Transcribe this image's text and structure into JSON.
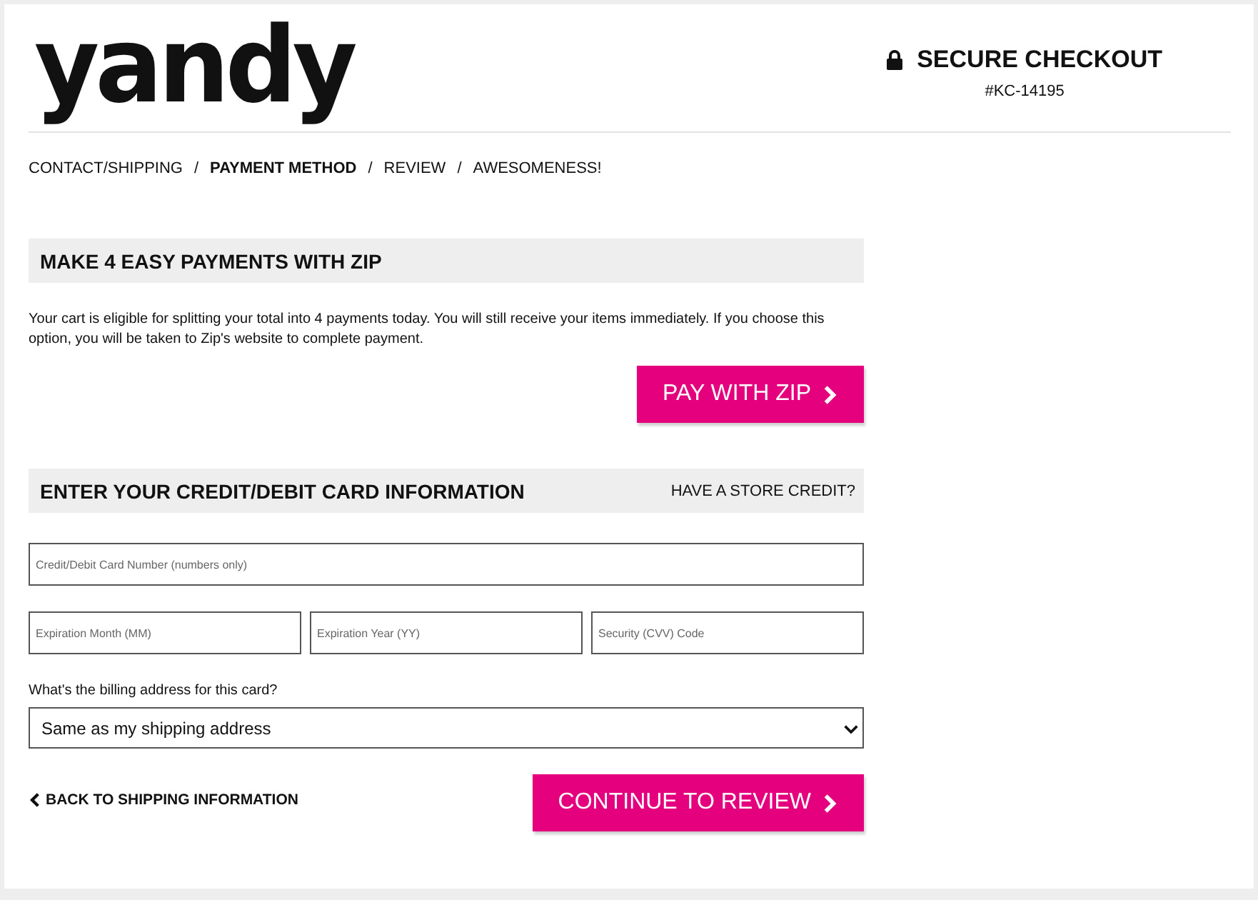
{
  "header": {
    "logo": "yandy",
    "secure_title": "SECURE CHECKOUT",
    "order_number": "#KC-14195"
  },
  "breadcrumb": [
    {
      "label": "CONTACT/SHIPPING",
      "selected": false
    },
    {
      "label": "PAYMENT METHOD",
      "selected": true
    },
    {
      "label": "REVIEW",
      "selected": false
    },
    {
      "label": "AWESOMENESS!",
      "selected": false
    }
  ],
  "breadcrumb_separator": "/",
  "zip_section": {
    "title": "MAKE 4 EASY PAYMENTS WITH ZIP",
    "text": "Your cart is eligible for splitting your total into 4 payments today. You will still receive your items immediately. If you choose this option, you will be taken to Zip's website to complete payment.",
    "button": "PAY WITH ZIP"
  },
  "card_section": {
    "title": "ENTER YOUR CREDIT/DEBIT CARD INFORMATION",
    "link": "HAVE A STORE CREDIT?",
    "fields": [
      {
        "placeholder": "Credit/Debit Card Number (numbers only)"
      }
    ],
    "field_row": [
      {
        "placeholder": "Expiration Month (MM)"
      },
      {
        "placeholder": "Expiration Year (YY)"
      },
      {
        "placeholder": "Security (CVV) Code"
      }
    ],
    "billing_label": "What's the billing address for this card?",
    "billing_select": {
      "value": "Same as my shipping address"
    }
  },
  "footer": {
    "back_link": "BACK TO SHIPPING INFORMATION",
    "continue_button": "CONTINUE TO REVIEW"
  }
}
